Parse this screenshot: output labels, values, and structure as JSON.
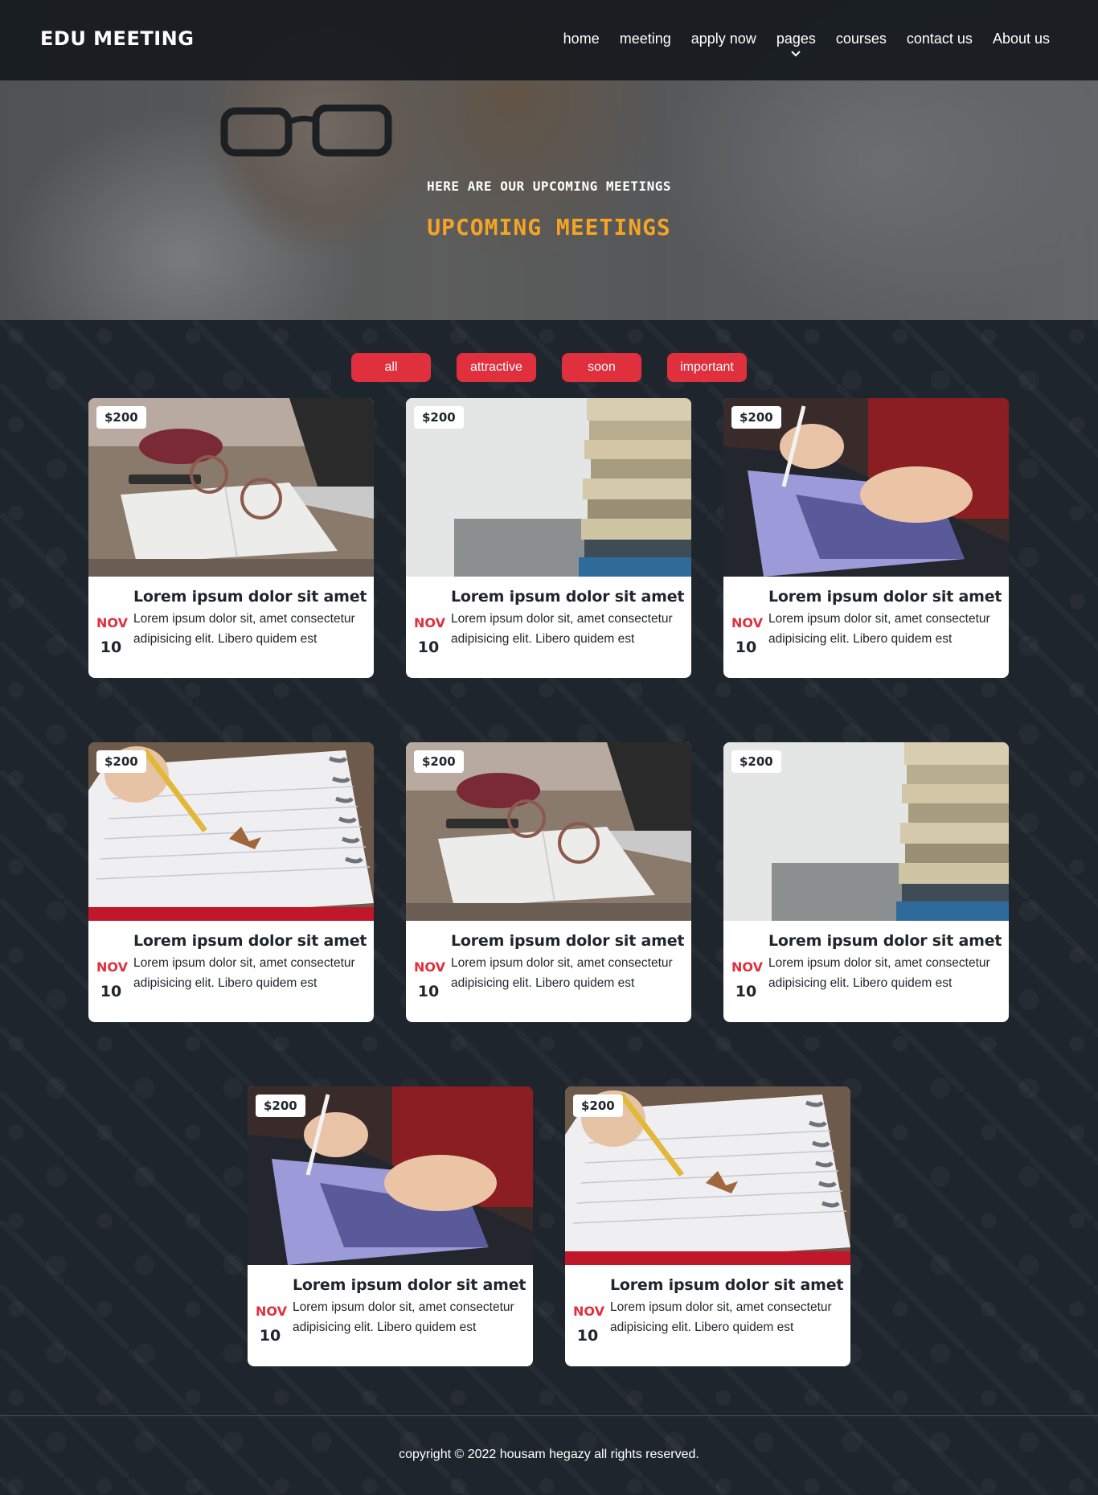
{
  "header": {
    "logo": "EDU MEETING",
    "nav": [
      "home",
      "meeting",
      "apply now",
      "pages",
      "courses",
      "contact us",
      "About us"
    ]
  },
  "hero": {
    "subtitle": "HERE ARE OUR UPCOMING MEETINGS",
    "title": "UPCOMING MEETINGS"
  },
  "filters": [
    "all",
    "attractive",
    "soon",
    "important"
  ],
  "cards": [
    {
      "price": "$200",
      "month": "NOV",
      "day": "10",
      "title": "Lorem ipsum dolor sit amet",
      "desc": "Lorem ipsum dolor sit, amet consectetur adipisicing elit. Libero quidem est",
      "image": "notebook-glasses"
    },
    {
      "price": "$200",
      "month": "NOV",
      "day": "10",
      "title": "Lorem ipsum dolor sit amet",
      "desc": "Lorem ipsum dolor sit, amet consectetur adipisicing elit. Libero quidem est",
      "image": "book-stack"
    },
    {
      "price": "$200",
      "month": "NOV",
      "day": "10",
      "title": "Lorem ipsum dolor sit amet",
      "desc": "Lorem ipsum dolor sit, amet consectetur adipisicing elit. Libero quidem est",
      "image": "tablet-writing"
    },
    {
      "price": "$200",
      "month": "NOV",
      "day": "10",
      "title": "Lorem ipsum dolor sit amet",
      "desc": "Lorem ipsum dolor sit, amet consectetur adipisicing elit. Libero quidem est",
      "image": "pencil-notebook"
    },
    {
      "price": "$200",
      "month": "NOV",
      "day": "10",
      "title": "Lorem ipsum dolor sit amet",
      "desc": "Lorem ipsum dolor sit, amet consectetur adipisicing elit. Libero quidem est",
      "image": "notebook-glasses"
    },
    {
      "price": "$200",
      "month": "NOV",
      "day": "10",
      "title": "Lorem ipsum dolor sit amet",
      "desc": "Lorem ipsum dolor sit, amet consectetur adipisicing elit. Libero quidem est",
      "image": "book-stack"
    },
    {
      "price": "$200",
      "month": "NOV",
      "day": "10",
      "title": "Lorem ipsum dolor sit amet",
      "desc": "Lorem ipsum dolor sit, amet consectetur adipisicing elit. Libero quidem est",
      "image": "tablet-writing"
    },
    {
      "price": "$200",
      "month": "NOV",
      "day": "10",
      "title": "Lorem ipsum dolor sit amet",
      "desc": "Lorem ipsum dolor sit, amet consectetur adipisicing elit. Libero quidem est",
      "image": "pencil-notebook"
    }
  ],
  "footer": {
    "text": "copyright © 2022 housam hegazy all rights reserved."
  },
  "colors": {
    "accent": "#e0303e",
    "hero_title": "#f5a425",
    "background": "#1f252c"
  }
}
